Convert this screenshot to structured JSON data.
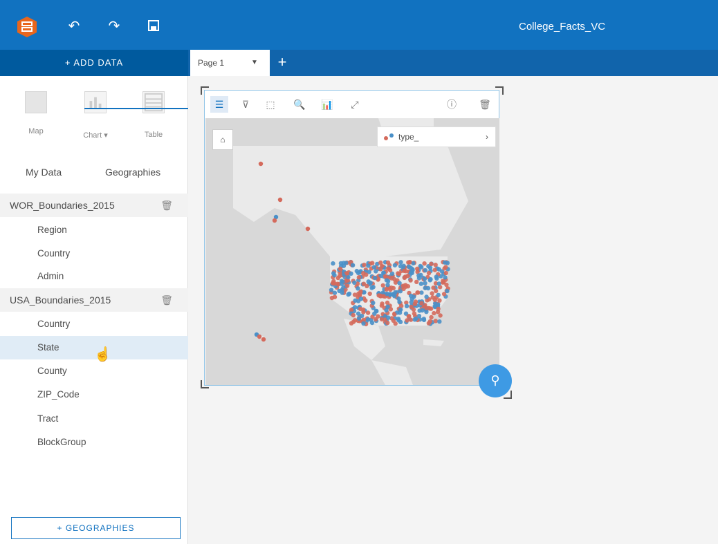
{
  "app": {
    "title": "College_Facts_VC",
    "brand_color": "#1172c0",
    "toolbar_icons": [
      "undo-icon",
      "redo-icon",
      "save-icon"
    ]
  },
  "add_data": {
    "label": "+ ADD DATA"
  },
  "page_tab": {
    "label": "Page 1",
    "add_icon": "+"
  },
  "viz_types": [
    {
      "label": "Map"
    },
    {
      "label": "Chart ▾"
    },
    {
      "label": "Table"
    }
  ],
  "tabs": [
    {
      "label": "My Data",
      "active": false
    },
    {
      "label": "Geographies",
      "active": true
    }
  ],
  "geographies": [
    {
      "name": "WOR_Boundaries_2015",
      "levels": [
        "Region",
        "Country",
        "Admin"
      ]
    },
    {
      "name": "USA_Boundaries_2015",
      "levels": [
        "Country",
        "State",
        "County",
        "ZIP_Code",
        "Tract",
        "BlockGroup"
      ]
    }
  ],
  "selected_level": "State",
  "geographies_button": {
    "label": "+ GEOGRAPHIES"
  },
  "card": {
    "legend_label": "type_",
    "point_colors": [
      "#d46a5c",
      "#4a90c8"
    ]
  }
}
